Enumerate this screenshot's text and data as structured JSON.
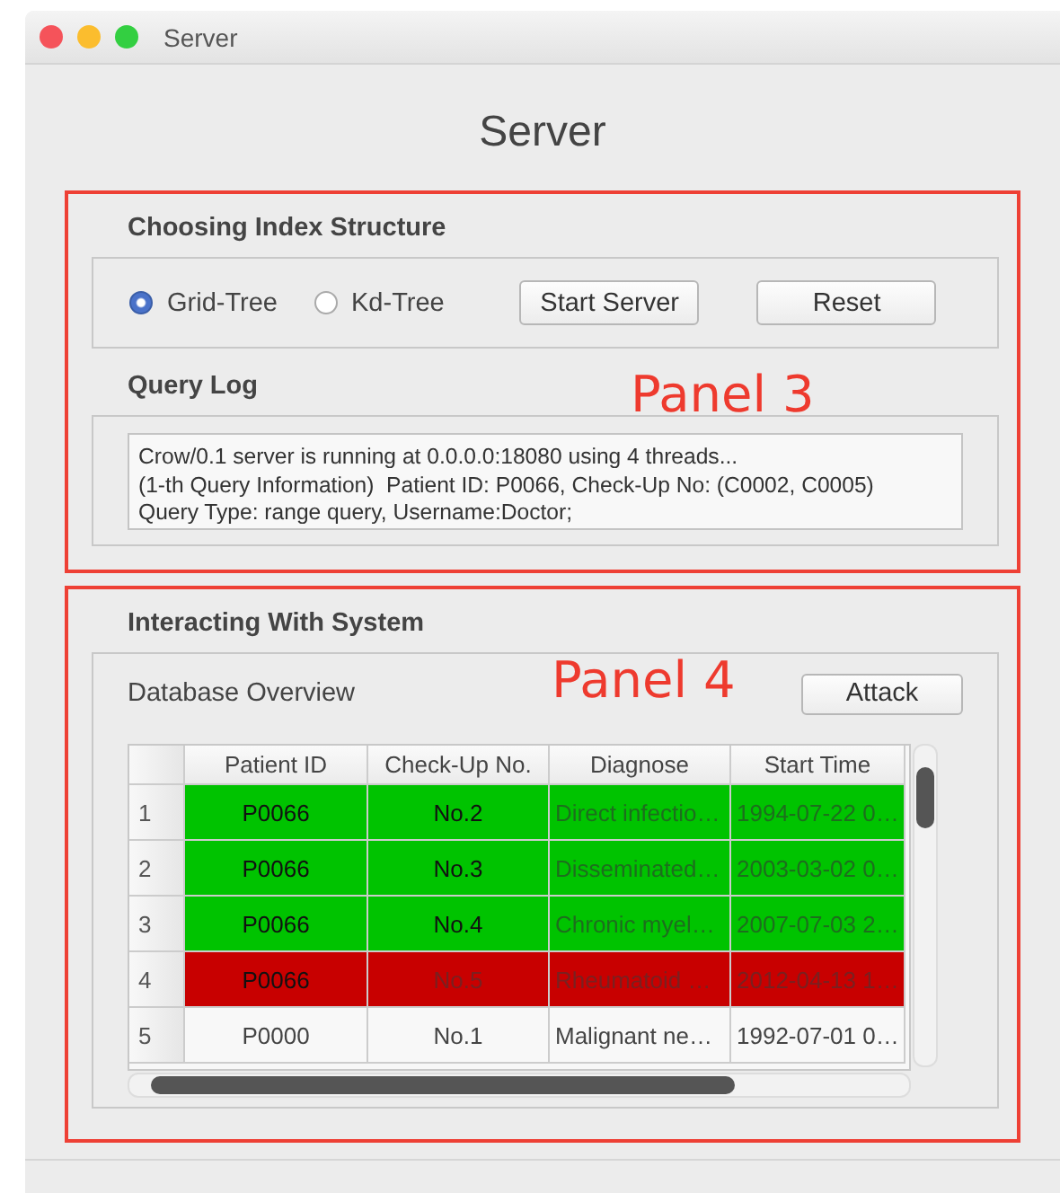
{
  "window": {
    "title": "Server"
  },
  "heading": "Server",
  "panel_3": {
    "annotation": "Panel 3",
    "index_group": {
      "title": "Choosing Index Structure",
      "options": [
        {
          "label": "Grid-Tree",
          "selected": true
        },
        {
          "label": "Kd-Tree",
          "selected": false
        }
      ],
      "buttons": [
        "Start Server",
        "Reset"
      ]
    },
    "query_log": {
      "title": "Query Log",
      "lines": [
        "Crow/0.1 server is running at 0.0.0.0:18080 using 4 threads...",
        "(1-th Query Information)  Patient ID: P0066, Check-Up No: (C0002, C0005)",
        "Query Type: range query, Username:Doctor;"
      ]
    }
  },
  "panel_4": {
    "annotation": "Panel 4",
    "title": "Interacting With System",
    "subtitle": "Database Overview",
    "button": "Attack",
    "table": {
      "columns": [
        "Patient ID",
        "Check-Up No.",
        "Diagnose",
        "Start Time"
      ],
      "rows": [
        {
          "index": "1",
          "kind": "match",
          "cells": [
            "P0066",
            "No.2",
            "Direct infectio…",
            "1994-07-22 0…"
          ]
        },
        {
          "index": "2",
          "kind": "match",
          "cells": [
            "P0066",
            "No.3",
            "Disseminated…",
            "2003-03-02 0…"
          ]
        },
        {
          "index": "3",
          "kind": "match",
          "cells": [
            "P0066",
            "No.4",
            "Chronic myel…",
            "2007-07-03 2…"
          ]
        },
        {
          "index": "4",
          "kind": "attack",
          "cells": [
            "P0066",
            "No.5",
            "Rheumatoid …",
            "2012-04-13 1…"
          ]
        },
        {
          "index": "5",
          "kind": "plain",
          "cells": [
            "P0000",
            "No.1",
            "Malignant ne…",
            "1992-07-01 0…"
          ]
        }
      ]
    }
  }
}
